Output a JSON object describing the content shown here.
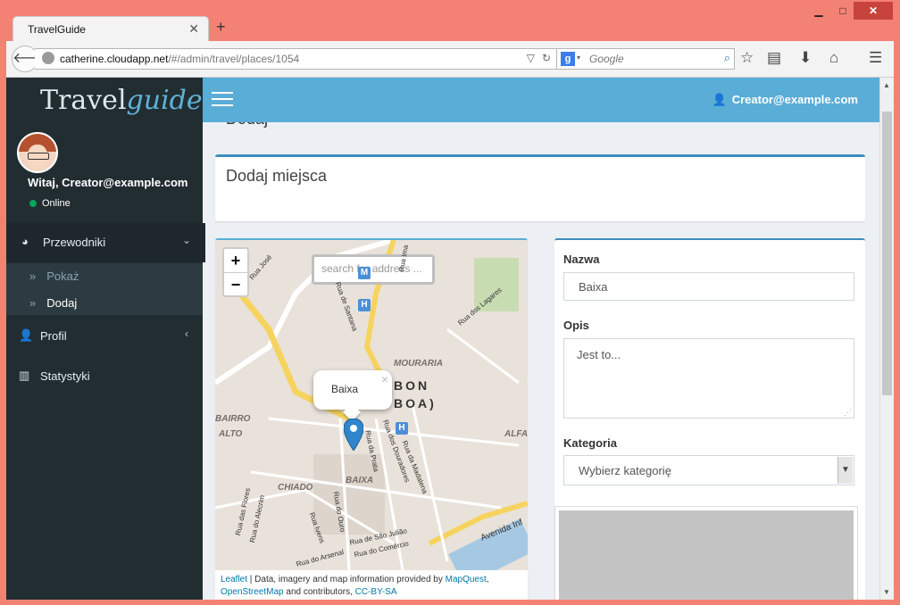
{
  "browser": {
    "tab_title": "TravelGuide",
    "url_host": "catherine.cloudapp.net",
    "url_path": "/#/admin/travel/places/1054",
    "search_placeholder": "Google"
  },
  "sidebar": {
    "brand_part1": "Travel",
    "brand_part2": "guide",
    "greeting": "Witaj, Creator@example.com",
    "status": "Online",
    "menu": [
      {
        "label": "Przewodniki",
        "icon": "dashboard-icon",
        "caret": "⌄"
      },
      {
        "label": "Profil",
        "icon": "user-icon",
        "caret": "‹"
      },
      {
        "label": "Statystyki",
        "icon": "bar-chart-icon"
      }
    ],
    "submenu": [
      {
        "label": "Pokaż"
      },
      {
        "label": "Dodaj"
      }
    ]
  },
  "header": {
    "user": "Creator@example.com"
  },
  "content": {
    "cut_title": "Dodaj",
    "box_title": "Dodaj miejsca"
  },
  "map": {
    "search_placeholder": "search for address ...",
    "popup_text": "Baixa",
    "zoom_in": "+",
    "zoom_out": "−",
    "labels": {
      "lisbon1": "BON",
      "lisbon2": "BOA)",
      "mouraria": "MOURARIA",
      "bairro": "BAIRRO",
      "alto": "ALTO",
      "chiado": "CHIADO",
      "baixa": "BAIXA",
      "alfa": "ALFA"
    },
    "streets": {
      "s1": "Rua de Santana",
      "s2": "Rua dos Douradores",
      "s3": "Rua da Prata",
      "s4": "Rua da Madalena",
      "s5": "Rua do Ouro",
      "s6": "Rua de São Julião",
      "s7": "Rua do Comércio",
      "s8": "Rua do Arsenal",
      "s9": "Avenida Inf",
      "s10": "Rua do Alecrim",
      "s11": "Rua das Flores",
      "s12": "Rua dos Lagares",
      "s13": "Rua Ivens",
      "s14": "Rua José",
      "s15": "Rua Ima"
    },
    "attrib_leaflet": "Leaflet",
    "attrib_text1": " | Data, imagery and map information provided by ",
    "attrib_mapquest": "MapQuest",
    "attrib_comma": ",",
    "attrib_osm": "OpenStreetMap",
    "attrib_text2": " and contributors, ",
    "attrib_cc": "CC-BY-SA"
  },
  "form": {
    "name_label": "Nazwa",
    "name_value": "Baixa",
    "desc_label": "Opis",
    "desc_value": "Jest to...",
    "category_label": "Kategoria",
    "category_value": "Wybierz kategorię"
  }
}
